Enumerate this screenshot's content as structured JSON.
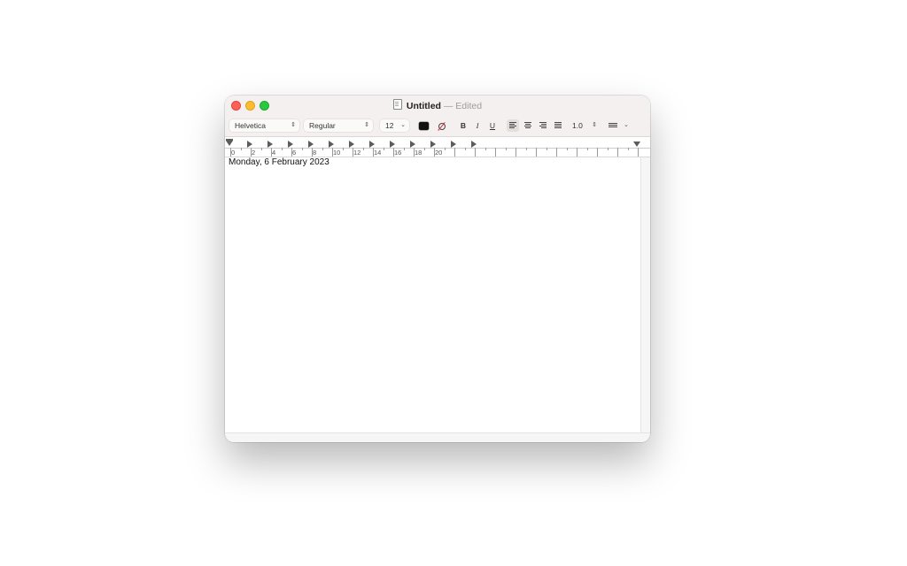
{
  "window": {
    "title": "Untitled",
    "status": "— Edited"
  },
  "toolbar": {
    "font_family": "Helvetica",
    "font_style": "Regular",
    "font_size": "12",
    "bold_label": "B",
    "italic_label": "I",
    "underline_label": "U",
    "line_spacing": "1.0",
    "text_color": "#000000"
  },
  "ruler": {
    "labels": [
      "0",
      "2",
      "4",
      "6",
      "8",
      "10",
      "12",
      "14",
      "16",
      "18",
      "20"
    ]
  },
  "document": {
    "text": "Monday, 6 February 2023"
  }
}
